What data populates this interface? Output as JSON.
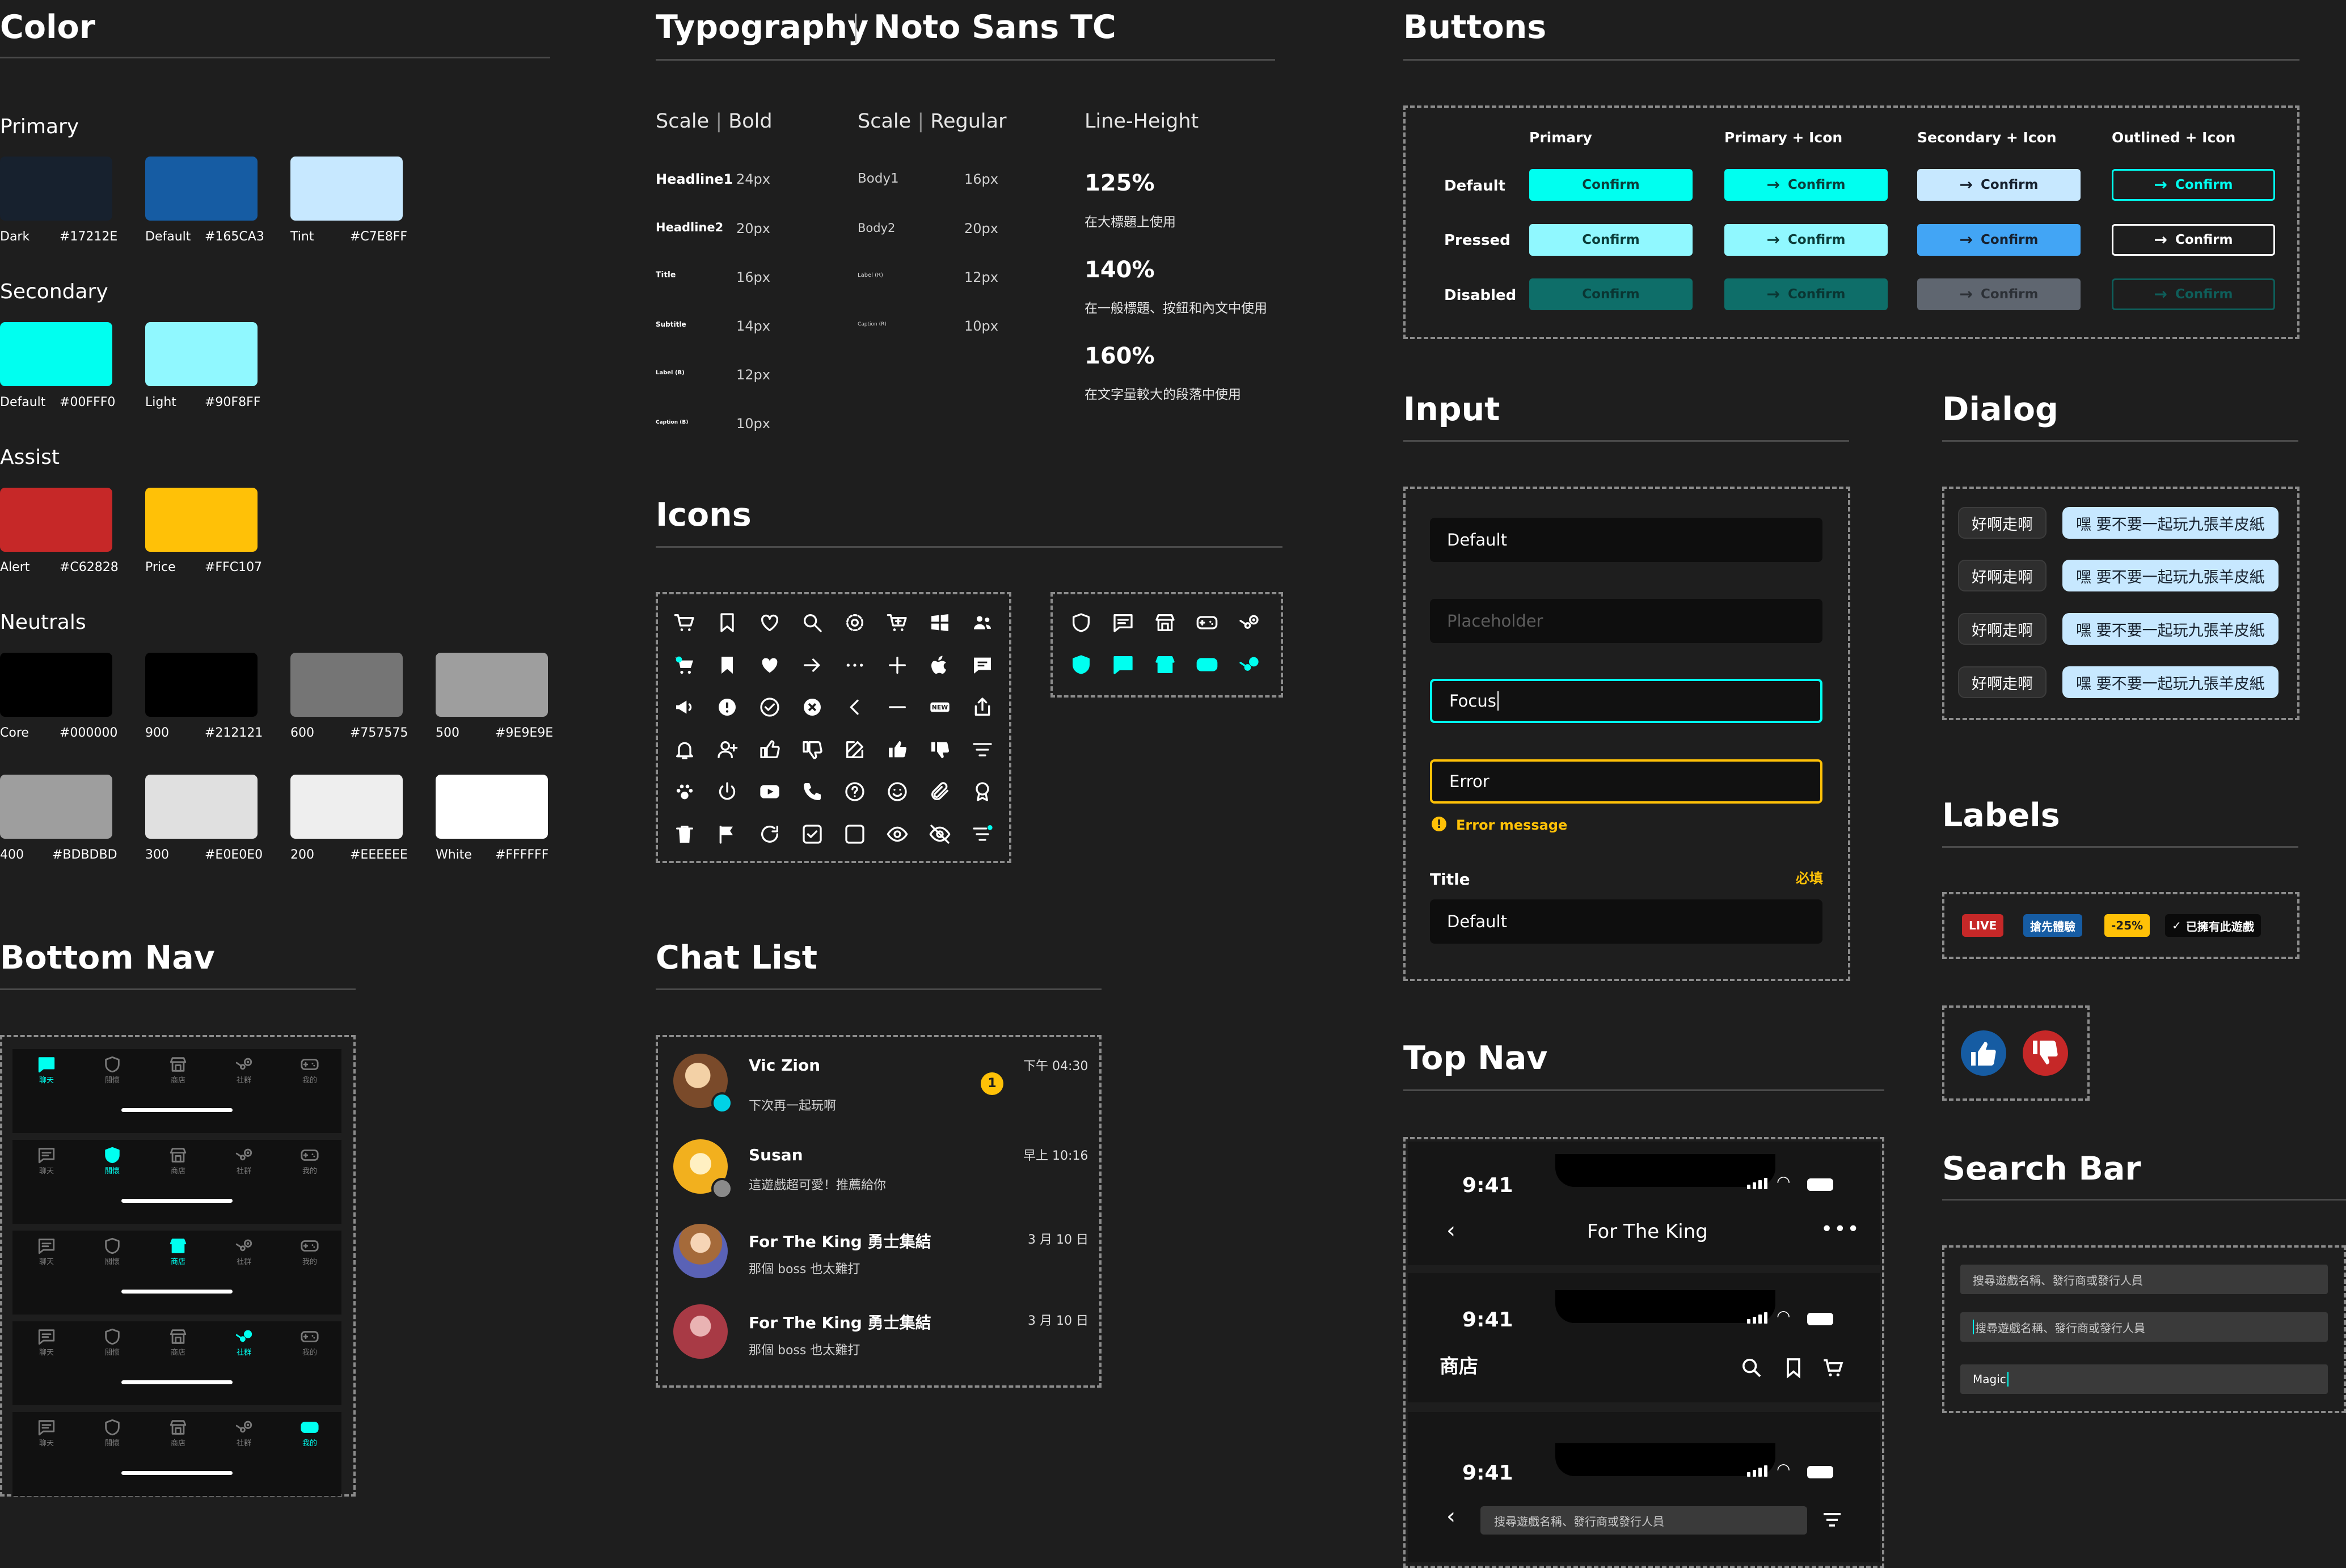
{
  "color": {
    "title": "Color",
    "primary": {
      "label": "Primary",
      "swatches": [
        {
          "name": "Dark",
          "hex": "#17212E"
        },
        {
          "name": "Default",
          "hex": "#165CA3"
        },
        {
          "name": "Tint",
          "hex": "#C7E8FF"
        }
      ]
    },
    "secondary": {
      "label": "Secondary",
      "swatches": [
        {
          "name": "Default",
          "hex": "#00FFF0"
        },
        {
          "name": "Light",
          "hex": "#90F8FF"
        }
      ]
    },
    "assist": {
      "label": "Assist",
      "swatches": [
        {
          "name": "Alert",
          "hex": "#C62828"
        },
        {
          "name": "Price",
          "hex": "#FFC107"
        }
      ]
    },
    "neutrals": {
      "label": "Neutrals",
      "swatches": [
        {
          "name": "Core",
          "hex": "#000000"
        },
        {
          "name": "900",
          "hex": "#212121"
        },
        {
          "name": "600",
          "hex": "#757575"
        },
        {
          "name": "500",
          "hex": "#9E9E9E"
        },
        {
          "name": "400",
          "hex": "#BDBDBD"
        },
        {
          "name": "300",
          "hex": "#E0E0E0"
        },
        {
          "name": "200",
          "hex": "#EEEEEE"
        },
        {
          "name": "White",
          "hex": "#FFFFFF"
        }
      ]
    }
  },
  "typography": {
    "title": "Typography",
    "font": "Noto Sans TC",
    "bold_head": {
      "a": "Scale",
      "b": "Bold"
    },
    "regular_head": {
      "a": "Scale",
      "b": "Regular"
    },
    "lineheight_head": "Line-Height",
    "bold": [
      {
        "name": "Headline1",
        "size": "24px"
      },
      {
        "name": "Headline2",
        "size": "20px"
      },
      {
        "name": "Title",
        "size": "16px"
      },
      {
        "name": "Subtitle",
        "size": "14px"
      },
      {
        "name": "Label (B)",
        "size": "12px"
      },
      {
        "name": "Caption (B)",
        "size": "10px"
      }
    ],
    "regular": [
      {
        "name": "Body1",
        "size": "16px"
      },
      {
        "name": "Body2",
        "size": "20px"
      },
      {
        "name": "Label (R)",
        "size": "12px"
      },
      {
        "name": "Caption (R)",
        "size": "10px"
      }
    ],
    "lineheights": [
      {
        "value": "125%",
        "desc": "在大標題上使用"
      },
      {
        "value": "140%",
        "desc": "在一般標題、按鈕和內文中使用"
      },
      {
        "value": "160%",
        "desc": "在文字量較大的段落中使用"
      }
    ]
  },
  "icons": {
    "title": "Icons"
  },
  "buttons": {
    "title": "Buttons",
    "columns": [
      "Primary",
      "Primary + Icon",
      "Secondary + Icon",
      "Outlined + Icon"
    ],
    "rows": [
      "Default",
      "Pressed",
      "Disabled"
    ],
    "label": "Confirm",
    "colors": {
      "primary_default": "#00FFF0",
      "primary_pressed": "#90F8FF",
      "primary_disabled": "#0E6E69",
      "secondary_default": "#C7E8FF",
      "secondary_pressed": "#42A5F5",
      "secondary_disabled": "#5F6670"
    }
  },
  "input": {
    "title": "Input",
    "default": "Default",
    "placeholder": "Placeholder",
    "focus": "Focus",
    "error": "Error",
    "error_message": "Error message",
    "field_title": "Title",
    "required": "必填",
    "titled_value": "Default"
  },
  "dialog": {
    "title": "Dialog",
    "rows": [
      {
        "left": "好啊走啊",
        "right": "嘿 要不要一起玩九張羊皮紙"
      },
      {
        "left": "好啊走啊",
        "right": "嘿 要不要一起玩九張羊皮紙"
      },
      {
        "left": "好啊走啊",
        "right": "嘿 要不要一起玩九張羊皮紙"
      },
      {
        "left": "好啊走啊",
        "right": "嘿 要不要一起玩九張羊皮紙"
      }
    ]
  },
  "labels": {
    "title": "Labels",
    "items": [
      "LIVE",
      "搶先體驗",
      "-25%",
      "已擁有此遊戲"
    ]
  },
  "bottom_nav": {
    "title": "Bottom Nav",
    "tabs": [
      "聊天",
      "關懷",
      "商店",
      "社群",
      "我的"
    ],
    "active": [
      0,
      1,
      2,
      3,
      4
    ]
  },
  "chat_list": {
    "title": "Chat List",
    "items": [
      {
        "name": "Vic Zion",
        "message": "下次再一起玩啊",
        "time": "下午 04:30",
        "unread": "1"
      },
      {
        "name": "Susan",
        "message": "這遊戲超可愛！推薦給你",
        "time": "早上 10:16"
      },
      {
        "name": "For The King 勇士集結",
        "message": "那個 boss 也太難打",
        "time": "3 月 10 日"
      },
      {
        "name": "For The King 勇士集結",
        "message": "那個 boss 也太難打",
        "time": "3 月 10 日"
      }
    ]
  },
  "top_nav": {
    "title": "Top Nav",
    "time": "9:41",
    "screen1_title": "For The King",
    "screen2_title": "商店",
    "search_placeholder": "搜尋遊戲名稱、發行商或發行人員"
  },
  "search_bar": {
    "title": "Search Bar",
    "placeholder": "搜尋遊戲名稱、發行商或發行人員",
    "typed": "Magic"
  }
}
